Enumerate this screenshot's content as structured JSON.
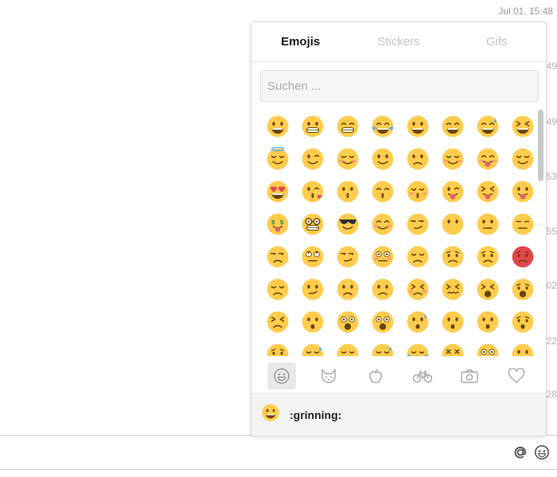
{
  "chat": {
    "timestamp": "Jul 01, 15:48",
    "time_fragments": [
      "49",
      "49",
      "53",
      "55",
      "02",
      "22",
      "28"
    ]
  },
  "picker": {
    "tabs": [
      {
        "label": "Emojis",
        "active": true
      },
      {
        "label": "Stickers",
        "active": false
      },
      {
        "label": "Gifs",
        "active": false
      }
    ],
    "search": {
      "placeholder": "Suchen ...",
      "value": ""
    },
    "preview": {
      "code": ":grinning:"
    },
    "categories": [
      "smiley-icon",
      "cat-icon",
      "apple-icon",
      "bicycle-icon",
      "camera-icon",
      "heart-icon"
    ],
    "emojis": [
      "grinning",
      "grimacing",
      "grin",
      "joy",
      "smiley",
      "smile",
      "sweat-smile",
      "laughing",
      "innocent",
      "wink",
      "blush",
      "slight-smile",
      "upside-down",
      "relaxed",
      "yum",
      "relieved",
      "heart-eyes",
      "kissing-heart",
      "kissing",
      "kissing-smiling",
      "kissing-closed-eyes",
      "stuck-out-tongue-wink",
      "stuck-out-tongue-closed",
      "stuck-out-tongue",
      "money-mouth",
      "nerd",
      "sunglasses",
      "hugging",
      "smirk",
      "no-mouth",
      "neutral",
      "expressionless",
      "unamused",
      "rolling-eyes",
      "thinking",
      "flushed",
      "disappointed",
      "worried",
      "angry",
      "rage",
      "pensive",
      "confused",
      "slight-frown",
      "frowning",
      "persevere",
      "confounded",
      "tired",
      "weary",
      "triumph",
      "open-mouth",
      "scream",
      "fearful",
      "cold-sweat",
      "hushed",
      "frowning-open",
      "anguished",
      "cry",
      "disappointed-relieved",
      "sleepy",
      "sweat",
      "sob",
      "dizzy",
      "astonished",
      "zipper-mouth"
    ]
  },
  "composer": {
    "icons": [
      "at-icon",
      "smiley-icon"
    ]
  },
  "colors": {
    "emoji_face": "#ffcc4d",
    "emoji_feature": "#664500",
    "rage_face": "#e2454c"
  }
}
